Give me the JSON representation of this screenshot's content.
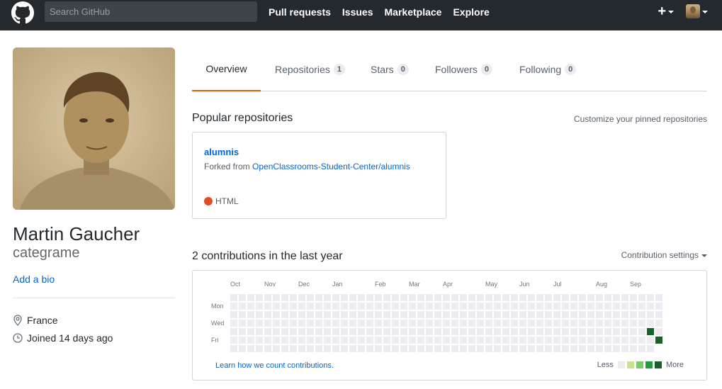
{
  "header": {
    "search_placeholder": "Search GitHub",
    "nav": [
      "Pull requests",
      "Issues",
      "Marketplace",
      "Explore"
    ],
    "plus": "+"
  },
  "profile": {
    "fullname": "Martin Gaucher",
    "username": "categrame",
    "add_bio": "Add a bio",
    "location": "France",
    "joined": "Joined 14 days ago"
  },
  "tabs": [
    {
      "label": "Overview",
      "count": null
    },
    {
      "label": "Repositories",
      "count": "1"
    },
    {
      "label": "Stars",
      "count": "0"
    },
    {
      "label": "Followers",
      "count": "0"
    },
    {
      "label": "Following",
      "count": "0"
    }
  ],
  "popular": {
    "title": "Popular repositories",
    "customize": "Customize your pinned repositories",
    "repo": {
      "name": "alumnis",
      "forked_prefix": "Forked from",
      "forked_from": "OpenClassrooms-Student-Center/alumnis",
      "language": "HTML",
      "language_color": "#e34c26"
    }
  },
  "contributions": {
    "title": "2 contributions in the last year",
    "settings": "Contribution settings",
    "months": [
      "Oct",
      "Nov",
      "Dec",
      "Jan",
      "Feb",
      "Mar",
      "Apr",
      "May",
      "Jun",
      "Jul",
      "Aug",
      "Sep"
    ],
    "days": [
      "Mon",
      "Wed",
      "Fri"
    ],
    "learn": "Learn how we count contributions.",
    "less": "Less",
    "more": "More",
    "colors": [
      "#ebedf0",
      "#c6e48b",
      "#7bc96f",
      "#239a3b",
      "#196127"
    ],
    "active_cells": [
      {
        "week": 49,
        "day": 4,
        "level": 4
      },
      {
        "week": 50,
        "day": 5,
        "level": 4
      }
    ]
  }
}
